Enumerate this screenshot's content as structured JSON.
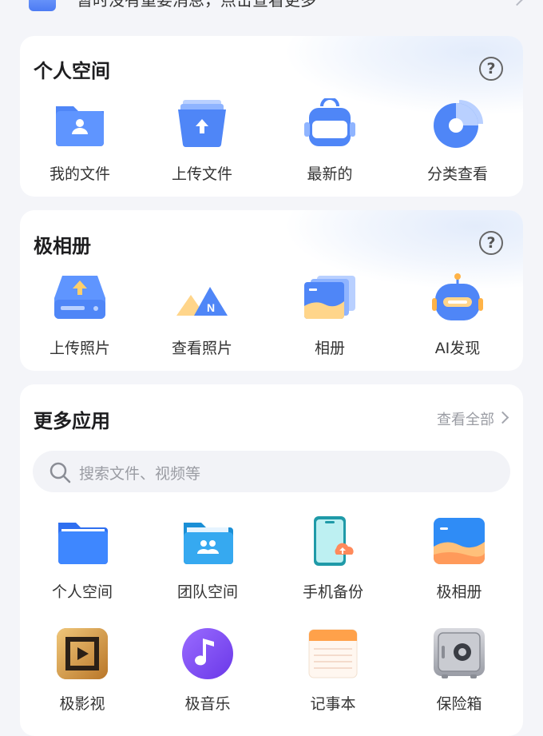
{
  "notice": {
    "text": "暂时没有重要消息，点击查看更多"
  },
  "personal": {
    "title": "个人空间",
    "help": "?",
    "items": [
      {
        "label": "我的文件",
        "icon": "folder-user-icon"
      },
      {
        "label": "上传文件",
        "icon": "upload-folder-icon"
      },
      {
        "label": "最新的",
        "icon": "backpack-icon"
      },
      {
        "label": "分类查看",
        "icon": "pie-chart-icon"
      }
    ]
  },
  "album": {
    "title": "极相册",
    "help": "?",
    "items": [
      {
        "label": "上传照片",
        "icon": "upload-photo-icon"
      },
      {
        "label": "查看照片",
        "icon": "mountain-photo-icon"
      },
      {
        "label": "相册",
        "icon": "photo-stack-icon"
      },
      {
        "label": "AI发现",
        "icon": "robot-icon"
      }
    ]
  },
  "more": {
    "title": "更多应用",
    "view_all": "查看全部",
    "search_placeholder": "搜索文件、视频等",
    "apps": [
      {
        "label": "个人空间",
        "icon": "blue-folder-icon"
      },
      {
        "label": "团队空间",
        "icon": "team-folder-icon"
      },
      {
        "label": "手机备份",
        "icon": "phone-backup-icon"
      },
      {
        "label": "极相册",
        "icon": "photo-album-icon"
      },
      {
        "label": "极影视",
        "icon": "video-icon"
      },
      {
        "label": "极音乐",
        "icon": "music-icon"
      },
      {
        "label": "记事本",
        "icon": "notepad-icon"
      },
      {
        "label": "保险箱",
        "icon": "safe-icon"
      }
    ]
  }
}
